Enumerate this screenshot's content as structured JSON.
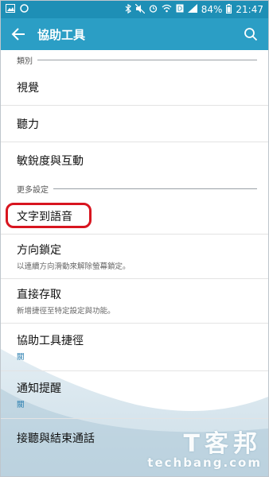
{
  "status_bar": {
    "battery": "84%",
    "time": "21:47",
    "icons": [
      "image-icon",
      "ring-icon",
      "bluetooth-icon",
      "mute-icon",
      "alarm-icon",
      "wifi-icon",
      "data-icon",
      "signal-icon",
      "battery-icon"
    ]
  },
  "app_bar": {
    "title": "協助工具",
    "back_icon": "arrow-left-icon",
    "search_icon": "search-icon"
  },
  "sections": [
    {
      "header": "類別",
      "items": [
        {
          "label": "視覺",
          "sub": ""
        },
        {
          "label": "聽力",
          "sub": ""
        },
        {
          "label": "敏銳度與互動",
          "sub": ""
        }
      ]
    },
    {
      "header": "更多設定",
      "items": [
        {
          "label": "文字到語音",
          "sub": ""
        },
        {
          "label": "方向鎖定",
          "sub": "以連續方向滑動來解除螢幕鎖定。"
        },
        {
          "label": "直接存取",
          "sub": "新增捷徑至特定設定與功能。"
        },
        {
          "label": "協助工具捷徑",
          "sub": "關"
        },
        {
          "label": "通知提醒",
          "sub": "關"
        },
        {
          "label": "接聽與結束通話",
          "sub": ""
        }
      ]
    }
  ],
  "watermark": {
    "line1": "T客邦",
    "line2": "techbang.com"
  },
  "colors": {
    "status_bar": "#1e8fb6",
    "app_bar": "#2b9ec5",
    "highlight": "#d8151f",
    "sub_blue": "#2b7fb0"
  }
}
